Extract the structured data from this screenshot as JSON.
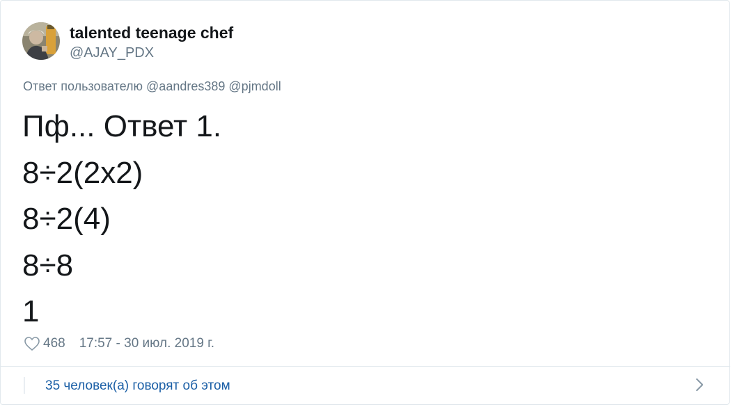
{
  "user": {
    "display_name": "talented teenage chef",
    "handle": "@AJAY_PDX",
    "avatar_icon": "user-avatar-photo"
  },
  "reply": {
    "prefix": "Ответ пользователю",
    "mentions": [
      "@aandres389",
      "@pjmdoll"
    ]
  },
  "tweet": {
    "lines": [
      "Пф... Ответ 1.",
      "8÷2(2x2)",
      "8÷2(4)",
      "8÷8",
      "1"
    ]
  },
  "meta": {
    "heart_icon": "heart-outline-icon",
    "like_count": "468",
    "timestamp": "17:57 - 30 июл. 2019 г."
  },
  "footer": {
    "talking_label": "35 человек(а) говорят об этом",
    "chevron_icon": "chevron-right-icon"
  },
  "colors": {
    "text_primary": "#14171a",
    "text_secondary": "#657786",
    "link": "#1b5fa6",
    "border": "#e1e8ed"
  }
}
